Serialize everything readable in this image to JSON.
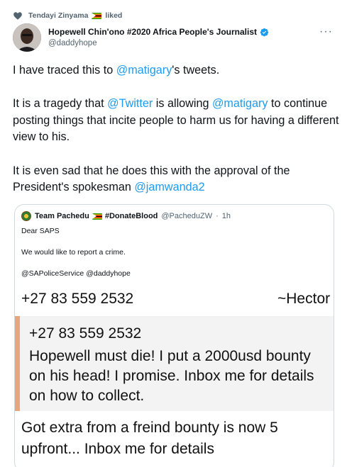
{
  "social_context": {
    "user": "Tendayi Zinyama",
    "action": "liked"
  },
  "tweet": {
    "author_name": "Hopewell Chin'ono #2020 Africa People's Journalist",
    "author_handle": "@daddyhope",
    "paragraphs": [
      [
        {
          "t": "I have traced this to "
        },
        {
          "m": "@matigary"
        },
        {
          "t": "'s tweets."
        }
      ],
      [
        {
          "t": "It is a tragedy that "
        },
        {
          "m": "@Twitter"
        },
        {
          "t": " is allowing "
        },
        {
          "m": "@matigary"
        },
        {
          "t": " to continue posting things that incite people to harm us for having a different view to his."
        }
      ],
      [
        {
          "t": "It is even sad that he does this with the approval of the President's spokesman "
        },
        {
          "m": "@jamwanda2"
        }
      ]
    ]
  },
  "quote": {
    "author_name": "Team Pachedu",
    "author_tag": "#DonateBlood",
    "author_handle": "@PacheduZW",
    "time": "1h",
    "line1": "Dear SAPS",
    "line2": "We would like to report a crime.",
    "line3": "@SAPoliceService @daddyhope",
    "image": {
      "phone": "+27 83 559 2532",
      "sender": "~Hector",
      "card_phone": "+27 83 559 2532",
      "card_line1": "Hopewell must die! I put a 2000usd bounty",
      "card_line2": "on his head!  I promise. Inbox me for details",
      "card_line3": "on how to collect.",
      "bottom_line1": "Got extra from a freind bounty is now 5",
      "bottom_line2": "upfront... Inbox me for details"
    }
  },
  "colors": {
    "link": "#1d9bf0",
    "secondary": "#536471",
    "verified": "#1d9bf0",
    "card_bar": "#e8a77a"
  }
}
